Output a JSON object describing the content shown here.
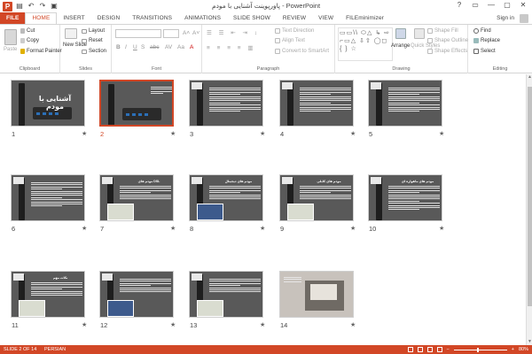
{
  "window": {
    "title": "پاورپوینت آشنایی با مودم - PowerPoint",
    "controls": [
      "?",
      "▭",
      "—",
      "▢",
      "✕"
    ]
  },
  "quick_access": {
    "app_icon": "P",
    "save_icon": "💾",
    "undo_icon": "↶",
    "redo_icon": "↷",
    "present_icon": "▣"
  },
  "tabs": {
    "file": "FILE",
    "items": [
      "HOME",
      "INSERT",
      "DESIGN",
      "TRANSITIONS",
      "ANIMATIONS",
      "SLIDE SHOW",
      "REVIEW",
      "VIEW",
      "FILEminimizer"
    ],
    "active": "HOME",
    "signin": "Sign in"
  },
  "ribbon": {
    "clipboard": {
      "label": "Clipboard",
      "paste": "Paste",
      "cut": "Cut",
      "copy": "Copy",
      "format_painter": "Format Painter"
    },
    "slides": {
      "label": "Slides",
      "new_slide": "New Slide",
      "layout": "Layout",
      "reset": "Reset",
      "section": "Section"
    },
    "font": {
      "label": "Font"
    },
    "paragraph": {
      "label": "Paragraph",
      "text_direction": "Text Direction",
      "align_text": "Align Text",
      "convert_smartart": "Convert to SmartArt"
    },
    "drawing": {
      "label": "Drawing",
      "arrange": "Arrange",
      "quick_styles": "Quick Styles",
      "shape_fill": "Shape Fill",
      "shape_outline": "Shape Outline",
      "shape_effects": "Shape Effects",
      "shapes_gallery": "▭▭\\\\ ⬭△ ↳ ⇨ ⌐▭△ ⇩⇧ ◯◻ { } ☆"
    },
    "editing": {
      "label": "Editing",
      "find": "Find",
      "replace": "Replace",
      "select": "Select"
    }
  },
  "slides": [
    {
      "num": "1",
      "title": "آشنایی با مودم",
      "kind": "title"
    },
    {
      "num": "2",
      "kind": "router",
      "selected": true
    },
    {
      "num": "3",
      "kind": "text",
      "badge": "۳"
    },
    {
      "num": "4",
      "kind": "text",
      "badge": "۴"
    },
    {
      "num": "5",
      "kind": "text",
      "badge": "۵"
    },
    {
      "num": "6",
      "kind": "text",
      "badge": "۶"
    },
    {
      "num": "7",
      "title": "مودم های DSL",
      "kind": "text-pic",
      "badge": "۷"
    },
    {
      "num": "8",
      "title": "مودم های دیجیتال",
      "kind": "text-pic",
      "badge": "۸"
    },
    {
      "num": "9",
      "title": "مودم های کابلی",
      "kind": "text-pic",
      "badge": "۹"
    },
    {
      "num": "10",
      "title": "مودم های ماهواره ای",
      "kind": "text",
      "badge": "۱۰"
    },
    {
      "num": "11",
      "title": "نکات مهم",
      "kind": "text-pic",
      "badge": "۱۱"
    },
    {
      "num": "12",
      "kind": "text-pic",
      "badge": "۱۲"
    },
    {
      "num": "13",
      "kind": "text-pic",
      "badge": "۱۳"
    },
    {
      "num": "14",
      "kind": "photo"
    }
  ],
  "slide_marker": "★",
  "status": {
    "slide_of": "SLIDE 2 OF 14",
    "language": "PERSIAN",
    "zoom": "80%",
    "zoom_fraction": 0.45
  },
  "colors": {
    "accent": "#d24726",
    "slide_bg": "#595959"
  }
}
